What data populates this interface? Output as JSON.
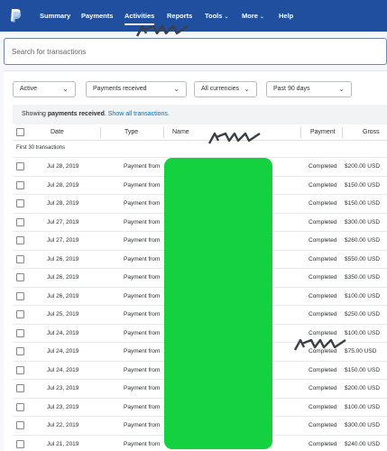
{
  "nav": {
    "logo_icon": "paypal-logo-icon",
    "items": [
      {
        "label": "Summary"
      },
      {
        "label": "Payments"
      },
      {
        "label": "Activities",
        "active": true
      },
      {
        "label": "Reports"
      },
      {
        "label": "Tools",
        "has_caret": true
      },
      {
        "label": "More",
        "has_caret": true
      },
      {
        "label": "Help"
      }
    ],
    "caret": "⌄"
  },
  "search": {
    "placeholder": "Search for transactions",
    "value": ""
  },
  "filters": {
    "status": "Active",
    "type": "Payments received",
    "currency": "All currencies",
    "period": "Past 90 days",
    "chevron": "⌄"
  },
  "info": {
    "prefix": "Showing",
    "bold": "payments received",
    "suffix": ".",
    "link": "Show all transactions."
  },
  "table": {
    "headers": {
      "date": "Date",
      "type": "Type",
      "name": "Name",
      "payment": "Payment",
      "gross": "Gross"
    },
    "group_label": "First 30 transactions",
    "rows": [
      {
        "date": "Jul 28, 2019",
        "type": "Payment from",
        "status": "Completed",
        "gross": "$200.00 USD"
      },
      {
        "date": "Jul 28, 2019",
        "type": "Payment from",
        "status": "Completed",
        "gross": "$150.00 USD"
      },
      {
        "date": "Jul 28, 2019",
        "type": "Payment from",
        "status": "Completed",
        "gross": "$150.00 USD"
      },
      {
        "date": "Jul 27, 2019",
        "type": "Payment from",
        "status": "Completed",
        "gross": "$300.00 USD"
      },
      {
        "date": "Jul 27, 2019",
        "type": "Payment from",
        "status": "Completed",
        "gross": "$260.00 USD"
      },
      {
        "date": "Jul 26, 2019",
        "type": "Payment from",
        "status": "Completed",
        "gross": "$550.00 USD"
      },
      {
        "date": "Jul 26, 2019",
        "type": "Payment from",
        "status": "Completed",
        "gross": "$350.00 USD"
      },
      {
        "date": "Jul 26, 2019",
        "type": "Payment from",
        "status": "Completed",
        "gross": "$100.00 USD"
      },
      {
        "date": "Jul 25, 2019",
        "type": "Payment from",
        "status": "Completed",
        "gross": "$250.00 USD"
      },
      {
        "date": "Jul 24, 2019",
        "type": "Payment from",
        "status": "Completed",
        "gross": "$100.00 USD"
      },
      {
        "date": "Jul 24, 2019",
        "type": "Payment from",
        "status": "Completed",
        "gross": "$75.00 USD"
      },
      {
        "date": "Jul 24, 2019",
        "type": "Payment from",
        "status": "Completed",
        "gross": "$150.00 USD"
      },
      {
        "date": "Jul 23, 2019",
        "type": "Payment from",
        "status": "Completed",
        "gross": "$200.00 USD"
      },
      {
        "date": "Jul 23, 2019",
        "type": "Payment from",
        "status": "Completed",
        "gross": "$100.00 USD"
      },
      {
        "date": "Jul 22, 2019",
        "type": "Payment from",
        "status": "Completed",
        "gross": "$300.00 USD"
      },
      {
        "date": "Jul 21, 2019",
        "type": "Payment from",
        "status": "Completed",
        "gross": "$240.00 USD"
      }
    ]
  },
  "colors": {
    "nav_bg": "#1f4f9e",
    "link": "#0070ba",
    "redaction": "#13d13f"
  }
}
